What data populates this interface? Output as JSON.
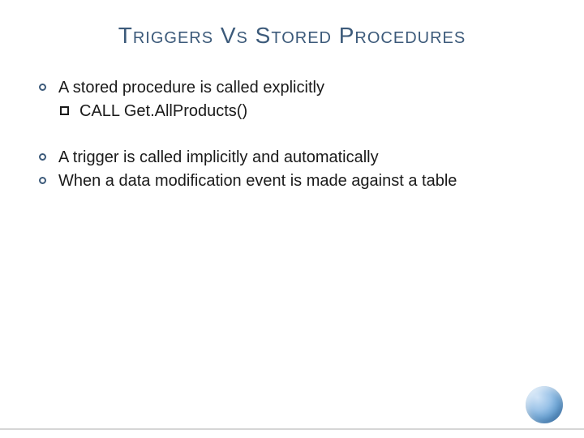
{
  "title": "Triggers Vs Stored Procedures",
  "bullets": {
    "b1": "A stored procedure is called explicitly",
    "b1a": "CALL Get.AllProducts()",
    "b2": "A trigger is called implicitly and automatically",
    "b3": "When a data modification event is made against a table"
  }
}
